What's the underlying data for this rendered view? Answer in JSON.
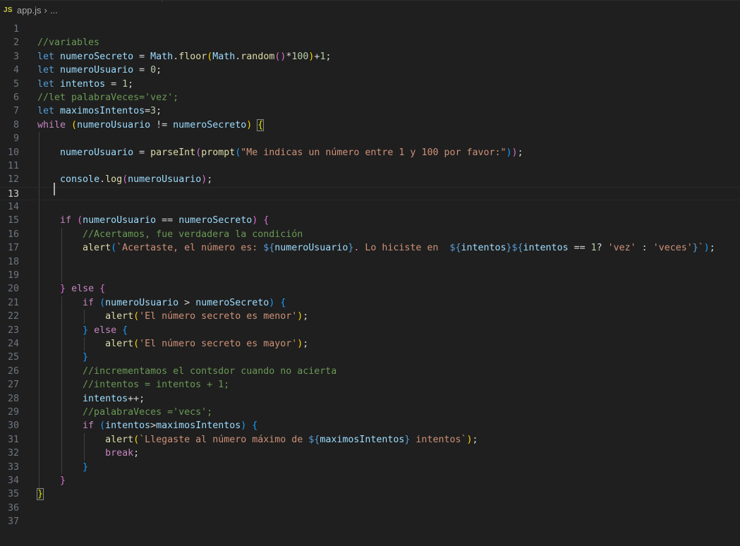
{
  "breadcrumb": {
    "file_icon": "JS",
    "file": "app.js",
    "separator": "›",
    "more": "..."
  },
  "editor": {
    "current_line": 13,
    "lines": [
      {
        "n": "1",
        "tokens": []
      },
      {
        "n": "2",
        "tokens": [
          {
            "t": "//variables",
            "c": "comment"
          }
        ]
      },
      {
        "n": "3",
        "tokens": [
          {
            "t": "let",
            "c": "keyword"
          },
          {
            "t": " ",
            "c": "punct"
          },
          {
            "t": "numeroSecreto",
            "c": "var"
          },
          {
            "t": " = ",
            "c": "punct"
          },
          {
            "t": "Math",
            "c": "var"
          },
          {
            "t": ".",
            "c": "punct"
          },
          {
            "t": "floor",
            "c": "func"
          },
          {
            "t": "(",
            "c": "b1"
          },
          {
            "t": "Math",
            "c": "var"
          },
          {
            "t": ".",
            "c": "punct"
          },
          {
            "t": "random",
            "c": "func"
          },
          {
            "t": "()",
            "c": "b2"
          },
          {
            "t": "*",
            "c": "punct"
          },
          {
            "t": "100",
            "c": "num"
          },
          {
            "t": ")",
            "c": "b1"
          },
          {
            "t": "+",
            "c": "punct"
          },
          {
            "t": "1",
            "c": "num"
          },
          {
            "t": ";",
            "c": "punct"
          }
        ]
      },
      {
        "n": "4",
        "tokens": [
          {
            "t": "let",
            "c": "keyword"
          },
          {
            "t": " ",
            "c": "punct"
          },
          {
            "t": "numeroUsuario",
            "c": "var"
          },
          {
            "t": " = ",
            "c": "punct"
          },
          {
            "t": "0",
            "c": "num"
          },
          {
            "t": ";",
            "c": "punct"
          }
        ]
      },
      {
        "n": "5",
        "tokens": [
          {
            "t": "let",
            "c": "keyword"
          },
          {
            "t": " ",
            "c": "punct"
          },
          {
            "t": "intentos",
            "c": "var"
          },
          {
            "t": " = ",
            "c": "punct"
          },
          {
            "t": "1",
            "c": "num"
          },
          {
            "t": ";",
            "c": "punct"
          }
        ]
      },
      {
        "n": "6",
        "tokens": [
          {
            "t": "//let palabraVeces='vez';",
            "c": "comment"
          }
        ]
      },
      {
        "n": "7",
        "tokens": [
          {
            "t": "let",
            "c": "keyword"
          },
          {
            "t": " ",
            "c": "punct"
          },
          {
            "t": "maximosIntentos",
            "c": "var"
          },
          {
            "t": "=",
            "c": "punct"
          },
          {
            "t": "3",
            "c": "num"
          },
          {
            "t": ";",
            "c": "punct"
          }
        ]
      },
      {
        "n": "8",
        "tokens": [
          {
            "t": "while",
            "c": "control"
          },
          {
            "t": " ",
            "c": "punct"
          },
          {
            "t": "(",
            "c": "b1"
          },
          {
            "t": "numeroUsuario",
            "c": "var"
          },
          {
            "t": " != ",
            "c": "punct"
          },
          {
            "t": "numeroSecreto",
            "c": "var"
          },
          {
            "t": ")",
            "c": "b1"
          },
          {
            "t": " ",
            "c": "punct"
          },
          {
            "t": "{",
            "c": "b1",
            "match": true
          }
        ]
      },
      {
        "n": "9",
        "tokens": []
      },
      {
        "n": "10",
        "tokens": [
          {
            "t": "    ",
            "c": "punct"
          },
          {
            "t": "numeroUsuario",
            "c": "var"
          },
          {
            "t": " = ",
            "c": "punct"
          },
          {
            "t": "parseInt",
            "c": "func"
          },
          {
            "t": "(",
            "c": "b2"
          },
          {
            "t": "prompt",
            "c": "func"
          },
          {
            "t": "(",
            "c": "b3"
          },
          {
            "t": "\"Me indicas un número entre 1 y 100 por favor:\"",
            "c": "str"
          },
          {
            "t": ")",
            "c": "b3"
          },
          {
            "t": ")",
            "c": "b2"
          },
          {
            "t": ";",
            "c": "punct"
          }
        ]
      },
      {
        "n": "11",
        "tokens": []
      },
      {
        "n": "12",
        "tokens": [
          {
            "t": "    ",
            "c": "punct"
          },
          {
            "t": "console",
            "c": "var"
          },
          {
            "t": ".",
            "c": "punct"
          },
          {
            "t": "log",
            "c": "func"
          },
          {
            "t": "(",
            "c": "b2"
          },
          {
            "t": "numeroUsuario",
            "c": "var"
          },
          {
            "t": ")",
            "c": "b2"
          },
          {
            "t": ";",
            "c": "punct"
          }
        ]
      },
      {
        "n": "13",
        "tokens": []
      },
      {
        "n": "14",
        "tokens": []
      },
      {
        "n": "15",
        "tokens": [
          {
            "t": "    ",
            "c": "punct"
          },
          {
            "t": "if",
            "c": "control"
          },
          {
            "t": " ",
            "c": "punct"
          },
          {
            "t": "(",
            "c": "b2"
          },
          {
            "t": "numeroUsuario",
            "c": "var"
          },
          {
            "t": " == ",
            "c": "punct"
          },
          {
            "t": "numeroSecreto",
            "c": "var"
          },
          {
            "t": ")",
            "c": "b2"
          },
          {
            "t": " ",
            "c": "punct"
          },
          {
            "t": "{",
            "c": "b2"
          }
        ]
      },
      {
        "n": "16",
        "tokens": [
          {
            "t": "        ",
            "c": "punct"
          },
          {
            "t": "//Acertamos, fue verdadera la condición",
            "c": "comment"
          }
        ]
      },
      {
        "n": "17",
        "tokens": [
          {
            "t": "        ",
            "c": "punct"
          },
          {
            "t": "alert",
            "c": "func"
          },
          {
            "t": "(",
            "c": "b3"
          },
          {
            "t": "`Acertaste, el número es: ",
            "c": "str"
          },
          {
            "t": "${",
            "c": "interp"
          },
          {
            "t": "numeroUsuario",
            "c": "var"
          },
          {
            "t": "}",
            "c": "interp"
          },
          {
            "t": ". Lo hiciste en  ",
            "c": "str"
          },
          {
            "t": "${",
            "c": "interp"
          },
          {
            "t": "intentos",
            "c": "var"
          },
          {
            "t": "}",
            "c": "interp"
          },
          {
            "t": "${",
            "c": "interp"
          },
          {
            "t": "intentos",
            "c": "var"
          },
          {
            "t": " == ",
            "c": "punct"
          },
          {
            "t": "1",
            "c": "num"
          },
          {
            "t": "? ",
            "c": "punct"
          },
          {
            "t": "'vez'",
            "c": "str"
          },
          {
            "t": " : ",
            "c": "punct"
          },
          {
            "t": "'veces'",
            "c": "str"
          },
          {
            "t": "}",
            "c": "interp"
          },
          {
            "t": "`",
            "c": "str"
          },
          {
            "t": ")",
            "c": "b3"
          },
          {
            "t": ";",
            "c": "punct"
          }
        ]
      },
      {
        "n": "18",
        "tokens": []
      },
      {
        "n": "19",
        "tokens": []
      },
      {
        "n": "20",
        "tokens": [
          {
            "t": "    ",
            "c": "punct"
          },
          {
            "t": "}",
            "c": "b2"
          },
          {
            "t": " ",
            "c": "punct"
          },
          {
            "t": "else",
            "c": "control"
          },
          {
            "t": " ",
            "c": "punct"
          },
          {
            "t": "{",
            "c": "b2"
          }
        ]
      },
      {
        "n": "21",
        "tokens": [
          {
            "t": "        ",
            "c": "punct"
          },
          {
            "t": "if",
            "c": "control"
          },
          {
            "t": " ",
            "c": "punct"
          },
          {
            "t": "(",
            "c": "b3"
          },
          {
            "t": "numeroUsuario",
            "c": "var"
          },
          {
            "t": " > ",
            "c": "punct"
          },
          {
            "t": "numeroSecreto",
            "c": "var"
          },
          {
            "t": ")",
            "c": "b3"
          },
          {
            "t": " ",
            "c": "punct"
          },
          {
            "t": "{",
            "c": "b3"
          }
        ]
      },
      {
        "n": "22",
        "tokens": [
          {
            "t": "            ",
            "c": "punct"
          },
          {
            "t": "alert",
            "c": "func"
          },
          {
            "t": "(",
            "c": "b1"
          },
          {
            "t": "'El número secreto es menor'",
            "c": "str"
          },
          {
            "t": ")",
            "c": "b1"
          },
          {
            "t": ";",
            "c": "punct"
          }
        ]
      },
      {
        "n": "23",
        "tokens": [
          {
            "t": "        ",
            "c": "punct"
          },
          {
            "t": "}",
            "c": "b3"
          },
          {
            "t": " ",
            "c": "punct"
          },
          {
            "t": "else",
            "c": "control"
          },
          {
            "t": " ",
            "c": "punct"
          },
          {
            "t": "{",
            "c": "b3"
          }
        ]
      },
      {
        "n": "24",
        "tokens": [
          {
            "t": "            ",
            "c": "punct"
          },
          {
            "t": "alert",
            "c": "func"
          },
          {
            "t": "(",
            "c": "b1"
          },
          {
            "t": "'El número secreto es mayor'",
            "c": "str"
          },
          {
            "t": ")",
            "c": "b1"
          },
          {
            "t": ";",
            "c": "punct"
          }
        ]
      },
      {
        "n": "25",
        "tokens": [
          {
            "t": "        ",
            "c": "punct"
          },
          {
            "t": "}",
            "c": "b3"
          }
        ]
      },
      {
        "n": "26",
        "tokens": [
          {
            "t": "        ",
            "c": "punct"
          },
          {
            "t": "//incrementamos el contsdor cuando no acierta",
            "c": "comment"
          }
        ]
      },
      {
        "n": "27",
        "tokens": [
          {
            "t": "        ",
            "c": "punct"
          },
          {
            "t": "//intentos = intentos + 1;",
            "c": "comment"
          }
        ]
      },
      {
        "n": "28",
        "tokens": [
          {
            "t": "        ",
            "c": "punct"
          },
          {
            "t": "intentos",
            "c": "var"
          },
          {
            "t": "++;",
            "c": "punct"
          }
        ]
      },
      {
        "n": "29",
        "tokens": [
          {
            "t": "        ",
            "c": "punct"
          },
          {
            "t": "//palabraVeces ='vecs';",
            "c": "comment"
          }
        ]
      },
      {
        "n": "30",
        "tokens": [
          {
            "t": "        ",
            "c": "punct"
          },
          {
            "t": "if",
            "c": "control"
          },
          {
            "t": " ",
            "c": "punct"
          },
          {
            "t": "(",
            "c": "b3"
          },
          {
            "t": "intentos",
            "c": "var"
          },
          {
            "t": ">",
            "c": "punct"
          },
          {
            "t": "maximosIntentos",
            "c": "var"
          },
          {
            "t": ")",
            "c": "b3"
          },
          {
            "t": " ",
            "c": "punct"
          },
          {
            "t": "{",
            "c": "b3"
          }
        ]
      },
      {
        "n": "31",
        "tokens": [
          {
            "t": "            ",
            "c": "punct"
          },
          {
            "t": "alert",
            "c": "func"
          },
          {
            "t": "(",
            "c": "b1"
          },
          {
            "t": "`Llegaste al número máximo de ",
            "c": "str"
          },
          {
            "t": "${",
            "c": "interp"
          },
          {
            "t": "maximosIntentos",
            "c": "var"
          },
          {
            "t": "}",
            "c": "interp"
          },
          {
            "t": " intentos`",
            "c": "str"
          },
          {
            "t": ")",
            "c": "b1"
          },
          {
            "t": ";",
            "c": "punct"
          }
        ]
      },
      {
        "n": "32",
        "tokens": [
          {
            "t": "            ",
            "c": "punct"
          },
          {
            "t": "break",
            "c": "control"
          },
          {
            "t": ";",
            "c": "punct"
          }
        ]
      },
      {
        "n": "33",
        "tokens": [
          {
            "t": "        ",
            "c": "punct"
          },
          {
            "t": "}",
            "c": "b3"
          }
        ]
      },
      {
        "n": "34",
        "tokens": [
          {
            "t": "    ",
            "c": "punct"
          },
          {
            "t": "}",
            "c": "b2"
          }
        ]
      },
      {
        "n": "35",
        "tokens": [
          {
            "t": "}",
            "c": "b1",
            "match": true
          }
        ]
      },
      {
        "n": "36",
        "tokens": []
      },
      {
        "n": "37",
        "tokens": []
      }
    ]
  }
}
